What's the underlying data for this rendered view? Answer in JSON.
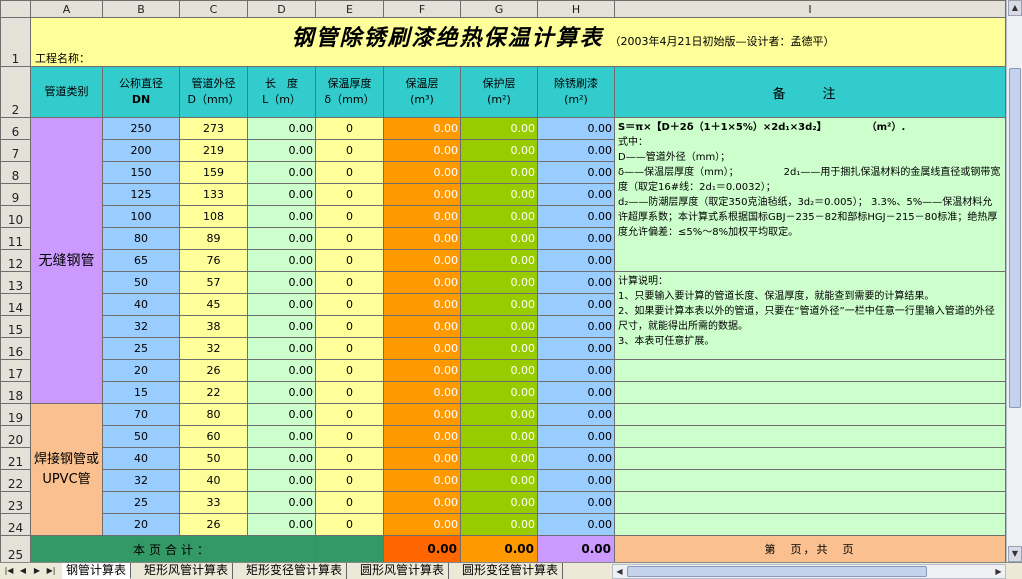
{
  "columns": [
    "A",
    "B",
    "C",
    "D",
    "E",
    "F",
    "G",
    "H",
    "I"
  ],
  "title": {
    "main": "钢管除锈刷漆绝热保温计算表",
    "sub": "（2003年4月21日初始版—设计者：孟德平）"
  },
  "project_label": "工程名称：",
  "headers": {
    "category": "管道类别",
    "dn_line1": "公称直径",
    "dn_line2": "DN",
    "od_line1": "管道外径",
    "od_line2": "D（mm）",
    "len_line1": "长　度",
    "len_line2": "L（m）",
    "ins_line1": "保温厚度",
    "ins_line2": "δ（mm）",
    "vol_line1": "保温层",
    "vol_line2": "(m³)",
    "prot_line1": "保护层",
    "prot_line2": "(m²)",
    "paint_line1": "除锈刷漆",
    "paint_line2": "(m²)",
    "note": "备　注"
  },
  "categories": {
    "seamless": "无缝钢管",
    "welded": "焊接钢管或UPVC管"
  },
  "seamless_rows": [
    {
      "row": "6",
      "dn": "250",
      "od": "273",
      "len": "0.00",
      "ins": "0",
      "vol": "0.00",
      "prot": "0.00",
      "paint": "0.00"
    },
    {
      "row": "7",
      "dn": "200",
      "od": "219",
      "len": "0.00",
      "ins": "0",
      "vol": "0.00",
      "prot": "0.00",
      "paint": "0.00"
    },
    {
      "row": "8",
      "dn": "150",
      "od": "159",
      "len": "0.00",
      "ins": "0",
      "vol": "0.00",
      "prot": "0.00",
      "paint": "0.00"
    },
    {
      "row": "9",
      "dn": "125",
      "od": "133",
      "len": "0.00",
      "ins": "0",
      "vol": "0.00",
      "prot": "0.00",
      "paint": "0.00"
    },
    {
      "row": "10",
      "dn": "100",
      "od": "108",
      "len": "0.00",
      "ins": "0",
      "vol": "0.00",
      "prot": "0.00",
      "paint": "0.00"
    },
    {
      "row": "11",
      "dn": "80",
      "od": "89",
      "len": "0.00",
      "ins": "0",
      "vol": "0.00",
      "prot": "0.00",
      "paint": "0.00"
    },
    {
      "row": "12",
      "dn": "65",
      "od": "76",
      "len": "0.00",
      "ins": "0",
      "vol": "0.00",
      "prot": "0.00",
      "paint": "0.00"
    },
    {
      "row": "13",
      "dn": "50",
      "od": "57",
      "len": "0.00",
      "ins": "0",
      "vol": "0.00",
      "prot": "0.00",
      "paint": "0.00"
    },
    {
      "row": "14",
      "dn": "40",
      "od": "45",
      "len": "0.00",
      "ins": "0",
      "vol": "0.00",
      "prot": "0.00",
      "paint": "0.00"
    },
    {
      "row": "15",
      "dn": "32",
      "od": "38",
      "len": "0.00",
      "ins": "0",
      "vol": "0.00",
      "prot": "0.00",
      "paint": "0.00"
    },
    {
      "row": "16",
      "dn": "25",
      "od": "32",
      "len": "0.00",
      "ins": "0",
      "vol": "0.00",
      "prot": "0.00",
      "paint": "0.00"
    },
    {
      "row": "17",
      "dn": "20",
      "od": "26",
      "len": "0.00",
      "ins": "0",
      "vol": "0.00",
      "prot": "0.00",
      "paint": "0.00"
    },
    {
      "row": "18",
      "dn": "15",
      "od": "22",
      "len": "0.00",
      "ins": "0",
      "vol": "0.00",
      "prot": "0.00",
      "paint": "0.00"
    }
  ],
  "welded_rows": [
    {
      "row": "19",
      "dn": "70",
      "od": "80",
      "len": "0.00",
      "ins": "0",
      "vol": "0.00",
      "prot": "0.00",
      "paint": "0.00"
    },
    {
      "row": "20",
      "dn": "50",
      "od": "60",
      "len": "0.00",
      "ins": "0",
      "vol": "0.00",
      "prot": "0.00",
      "paint": "0.00"
    },
    {
      "row": "21",
      "dn": "40",
      "od": "50",
      "len": "0.00",
      "ins": "0",
      "vol": "0.00",
      "prot": "0.00",
      "paint": "0.00"
    },
    {
      "row": "22",
      "dn": "32",
      "od": "40",
      "len": "0.00",
      "ins": "0",
      "vol": "0.00",
      "prot": "0.00",
      "paint": "0.00"
    },
    {
      "row": "23",
      "dn": "25",
      "od": "33",
      "len": "0.00",
      "ins": "0",
      "vol": "0.00",
      "prot": "0.00",
      "paint": "0.00"
    },
    {
      "row": "24",
      "dn": "20",
      "od": "26",
      "len": "0.00",
      "ins": "0",
      "vol": "0.00",
      "prot": "0.00",
      "paint": "0.00"
    }
  ],
  "notes": {
    "formula": "S＝π×【D＋2δ（1＋1×5%）×2d₁×3d₂】　　　　　（m²）.",
    "where": "式中：",
    "d_def": "D——管道外径（mm）；",
    "delta_def": "δ——保温层厚度（mm）；　　　　　2d₁——用于捆扎保温材料的金属线直径或钢带宽度（取定16#线：2d₁＝0.0032）；",
    "d2_def": "d₂——防潮层厚度（取定350克油毡纸，3d₂＝0.005）； 3.3%、5%——保温材料允许超厚系数；本计算式系根据国标GBJ－235－82和部标HGJ－215－80标准；绝热厚度允许偏差：≤5%～8%加权平均取定。",
    "calc_title": "计算说明：",
    "calc_1": "1、只要输入要计算的管道长度、保温厚度，就能查到需要的计算结果。",
    "calc_2": "2、如果要计算本表以外的管道，只要在“管道外径”一栏中任意一行里输入管道的外径尺寸，就能得出所需的数据。",
    "calc_3": "3、本表可任意扩展。"
  },
  "summary": {
    "row": "25",
    "label": "本页合计：",
    "vol": "0.00",
    "prot": "0.00",
    "paint": "0.00",
    "page": "第　页，共　页"
  },
  "row_numbers": {
    "r1": "1",
    "r2": "2"
  },
  "sheet_tabs": [
    "钢管计算表",
    "矩形风管计算表",
    "矩形变径管计算表",
    "圆形风管计算表",
    "圆形变径管计算表"
  ],
  "active_tab": "钢管计算表"
}
